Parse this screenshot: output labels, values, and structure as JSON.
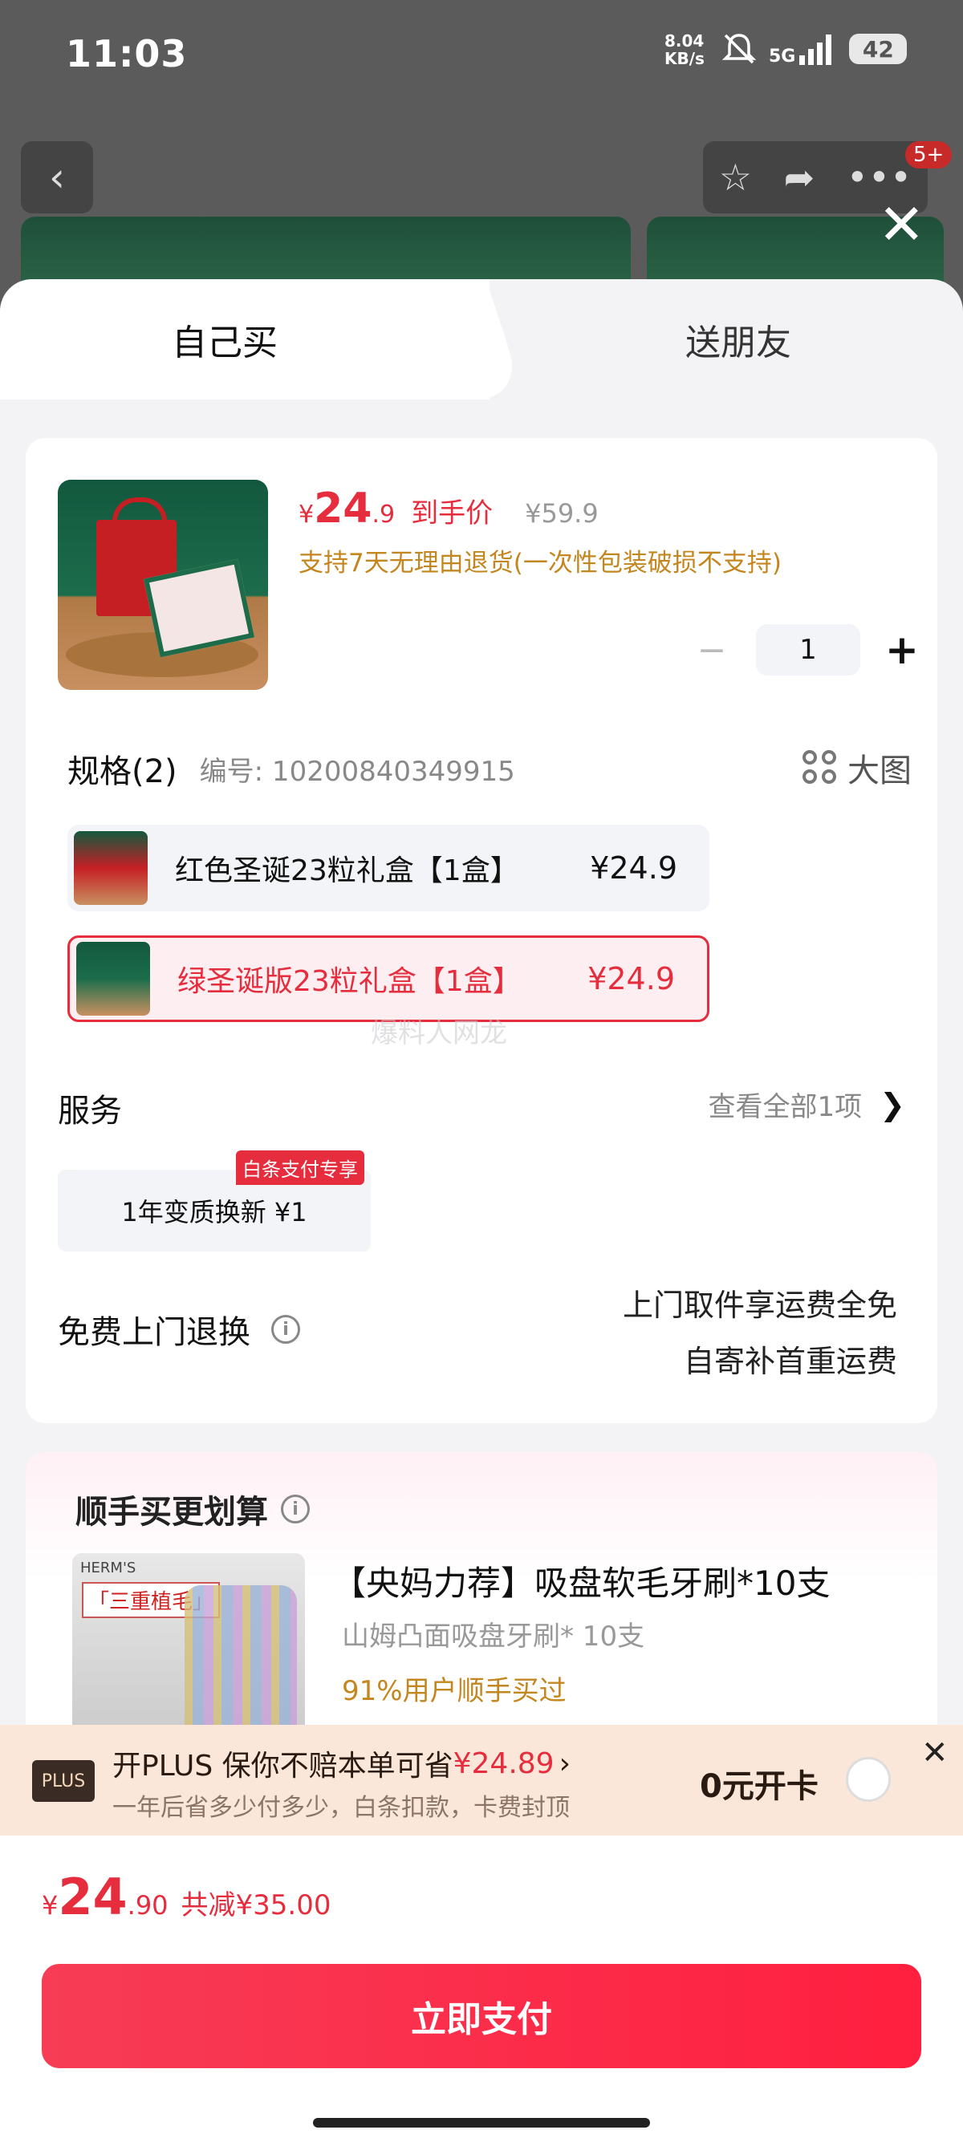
{
  "status": {
    "time": "11:03",
    "speed_value": "8.04",
    "speed_unit": "KB/s",
    "network": "5G",
    "battery": "42"
  },
  "background": {
    "badge": "5+"
  },
  "tabs": {
    "self": "自己买",
    "friend": "送朋友"
  },
  "product": {
    "price_int": "24",
    "price_dec": ".9",
    "currency": "¥",
    "price_tag": "到手价",
    "original_price": "¥59.9",
    "return_note": "支持7天无理由退货(一次性包装破损不支持)",
    "quantity": "1",
    "minus": "−",
    "plus": "+"
  },
  "spec": {
    "title": "规格(2)",
    "code": "编号: 10200840349915",
    "big_image": "大图",
    "options": [
      {
        "label": "红色圣诞23粒礼盒【1盒】",
        "price": "¥24.9"
      },
      {
        "label": "绿圣诞版23粒礼盒【1盒】",
        "price": "¥24.9"
      }
    ]
  },
  "watermark": "爆料人网龙",
  "service": {
    "title": "服务",
    "view_all": "查看全部1项",
    "chevron": "❯",
    "chip": "1年变质换新  ¥1",
    "chip_badge": "白条支付专享"
  },
  "return_service": {
    "title": "免费上门退换",
    "line1": "上门取件享运费全免",
    "line2": "自寄补首重运费"
  },
  "addon": {
    "title": "顺手买更划算",
    "brand": "HERM'S",
    "image_label": "「三重植毛」",
    "item_title": "【央妈力荐】吸盘软毛牙刷*10支",
    "item_sub": "山姆凸面吸盘牙刷* 10支",
    "item_pct": "91%用户顺手买过"
  },
  "plus": {
    "logo": "PLUS",
    "line1_prefix": "开PLUS 保你不赔本单可省",
    "line1_amount": "¥24.89",
    "line1_chevron": "›",
    "line2": "一年后省多少付多少，白条扣款，卡费封顶",
    "open": "0元开卡",
    "close": "✕"
  },
  "pay": {
    "currency": "¥",
    "total_int": "24",
    "total_dec": ".90",
    "reduce": "共减¥35.00",
    "button": "立即支付"
  }
}
